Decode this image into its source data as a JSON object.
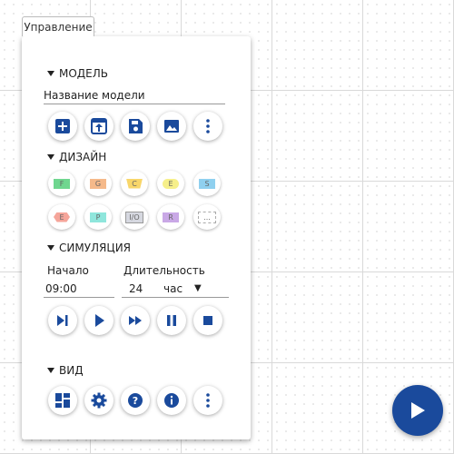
{
  "panel": {
    "tab_label": "Управление"
  },
  "model": {
    "header": "МОДЕЛЬ",
    "name_value": "Название модели",
    "buttons": [
      "add-icon",
      "upload-icon",
      "save-icon",
      "image-icon",
      "more-vert-icon"
    ]
  },
  "design": {
    "header": "ДИЗАЙН",
    "shapes": [
      {
        "label": "F",
        "color": "#6fd68f"
      },
      {
        "label": "G",
        "color": "#f5b98a"
      },
      {
        "label": "C",
        "color": "#f8d66a"
      },
      {
        "label": "E",
        "color": "#f6ef8a"
      },
      {
        "label": "S",
        "color": "#8fd0ef"
      },
      {
        "label": "E",
        "color": "#f5a59a"
      },
      {
        "label": "P",
        "color": "#8fe6dc"
      },
      {
        "label": "I/O",
        "color": "#d6d8e0"
      },
      {
        "label": "R",
        "color": "#c9a8e6"
      },
      {
        "label": "...",
        "color": "#ffffff"
      }
    ]
  },
  "simulation": {
    "header": "СИМУЛЯЦИЯ",
    "start_label": "Начало",
    "start_value": "09:00",
    "duration_label": "Длительность",
    "duration_value": "24",
    "duration_unit": "час",
    "buttons": [
      "step-icon",
      "play-icon",
      "fast-forward-icon",
      "pause-icon",
      "stop-icon"
    ]
  },
  "view": {
    "header": "ВИД",
    "buttons": [
      "dashboard-icon",
      "settings-icon",
      "help-icon",
      "info-icon",
      "more-vert-icon"
    ]
  },
  "colors": {
    "accent": "#1a4a9c"
  }
}
